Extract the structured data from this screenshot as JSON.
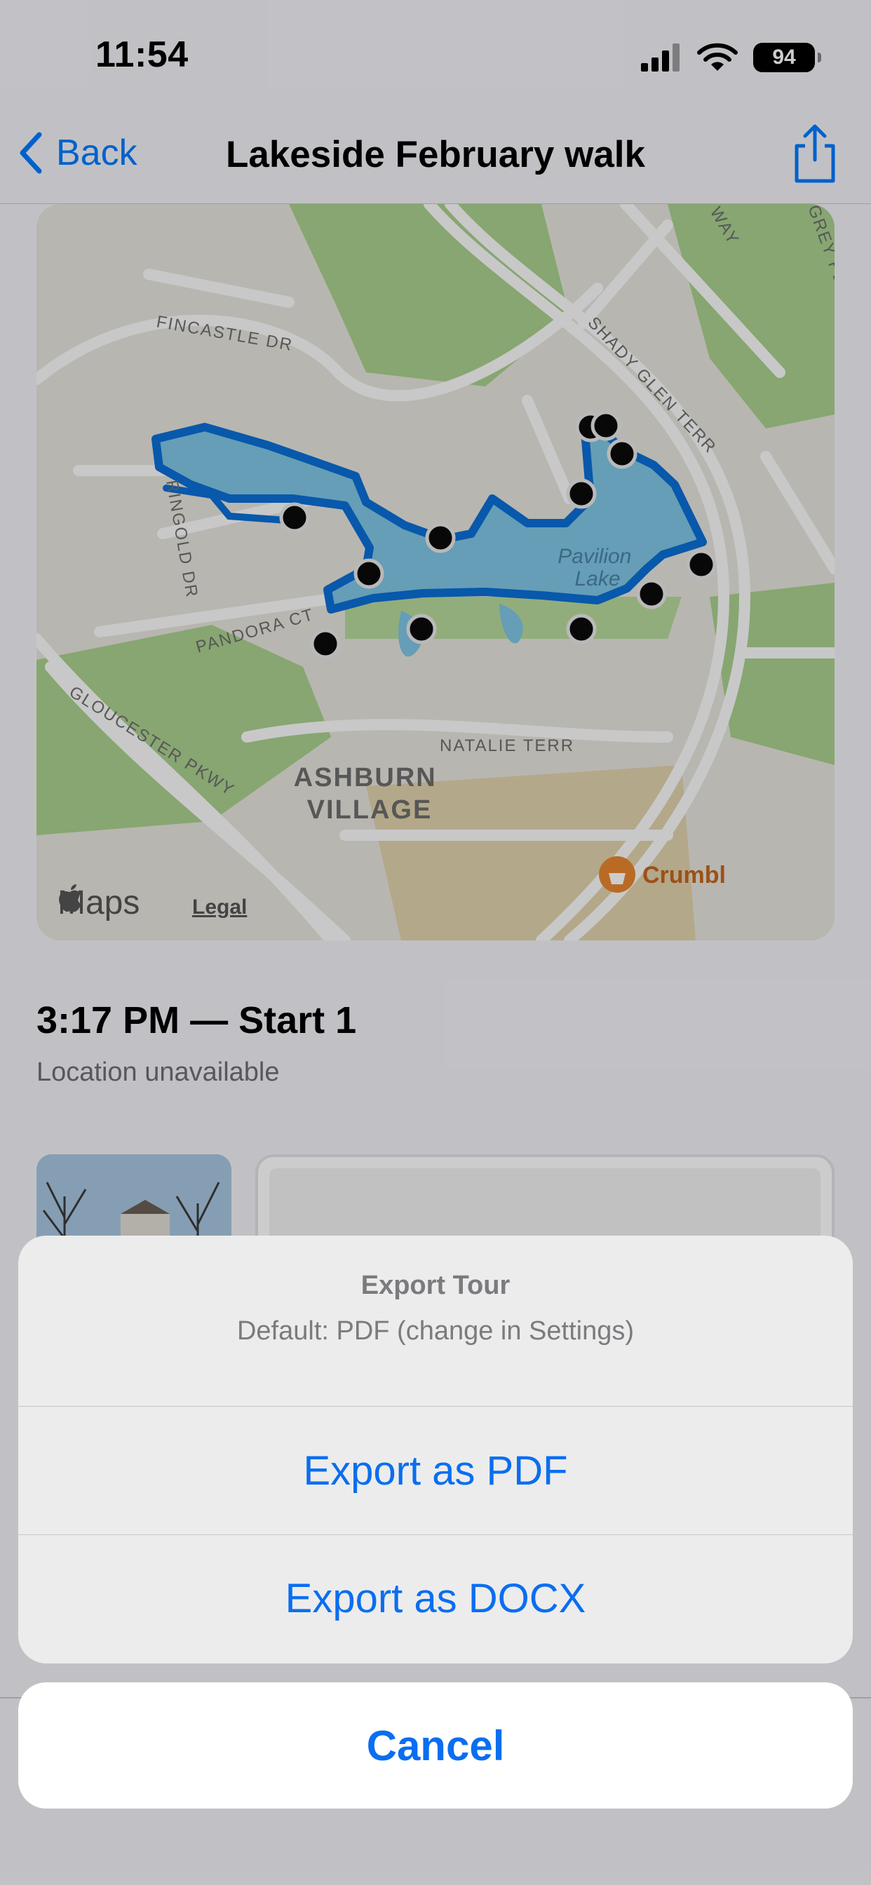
{
  "status_bar": {
    "time": "11:54",
    "battery": "94"
  },
  "nav": {
    "back_label": "Back",
    "title": "Lakeside February walk",
    "share_icon": "share-icon"
  },
  "map": {
    "lake_label_line1": "Pavilion",
    "lake_label_line2": "Lake",
    "streets": {
      "fincastle": "FINCASTLE DR",
      "shady_glen": "SHADY GLEN TERR",
      "ringold": "RINGOLD DR",
      "pandora": "PANDORA CT",
      "gloucester": "GLOUCESTER PKWY",
      "natalie": "NATALIE TERR",
      "way": "WAY",
      "grey": "GREY PL"
    },
    "area_line1": "ASHBURN",
    "area_line2": "VILLAGE",
    "poi_label": "Crumbl",
    "maps_brand": "Maps",
    "legal": "Legal",
    "colors": {
      "water": "#7fc6e4",
      "route": "#0b6fd6",
      "park": "#a9d08e",
      "land": "#e7e4dc"
    }
  },
  "stop": {
    "title": "3:17 PM — Start 1",
    "location": "Location unavailable"
  },
  "action_sheet": {
    "title": "Export Tour",
    "subtitle": "Default: PDF (change in Settings)",
    "options": [
      "Export as PDF",
      "Export as DOCX"
    ],
    "cancel": "Cancel"
  },
  "accent": "#007aff"
}
